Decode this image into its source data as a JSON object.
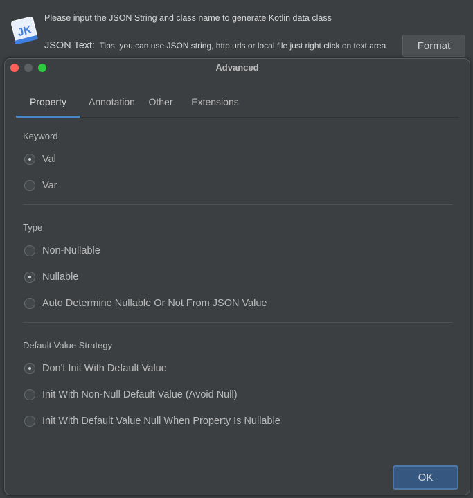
{
  "parent": {
    "header": "Please input the JSON String and class name to generate Kotlin data class",
    "json_label": "JSON Text:",
    "json_tips": "Tips: you can use JSON string, http urls or local file just right click on text area",
    "format_label": "Format",
    "logo_text": "JK"
  },
  "dialog": {
    "title": "Advanced",
    "tabs": [
      {
        "label": "Property",
        "active": true
      },
      {
        "label": "Annotation",
        "active": false
      },
      {
        "label": "Other",
        "active": false
      },
      {
        "label": "Extensions",
        "active": false
      }
    ],
    "sections": [
      {
        "title": "Keyword",
        "options": [
          {
            "label": "Val",
            "checked": true
          },
          {
            "label": "Var",
            "checked": false
          }
        ]
      },
      {
        "title": "Type",
        "options": [
          {
            "label": "Non-Nullable",
            "checked": false
          },
          {
            "label": "Nullable",
            "checked": true
          },
          {
            "label": "Auto Determine Nullable Or Not From JSON Value",
            "checked": false
          }
        ]
      },
      {
        "title": "Default Value Strategy",
        "options": [
          {
            "label": "Don't Init With Default Value",
            "checked": true
          },
          {
            "label": "Init With Non-Null Default Value (Avoid Null)",
            "checked": false
          },
          {
            "label": "Init With Default Value Null When Property Is Nullable",
            "checked": false
          }
        ]
      }
    ],
    "ok_label": "OK"
  },
  "colors": {
    "background": "#3c3f41",
    "accent": "#4a88c7",
    "ok_button": "#365880",
    "traffic_red": "#fe5f57",
    "traffic_green": "#2bc840"
  }
}
